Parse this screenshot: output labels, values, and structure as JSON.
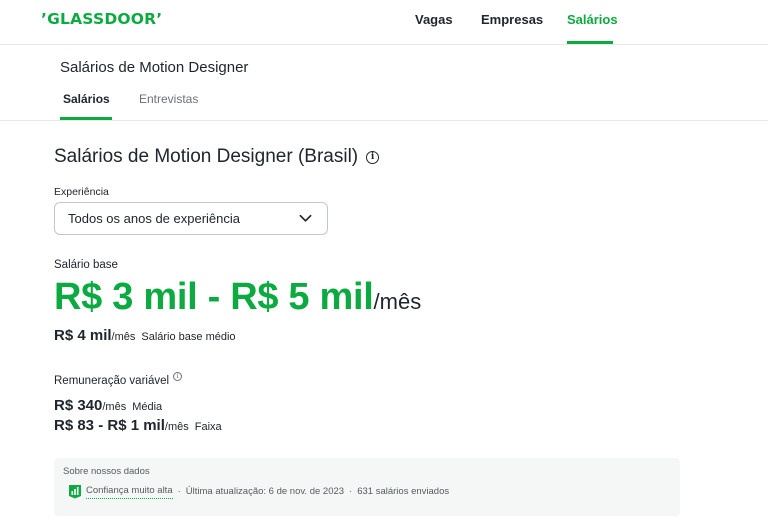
{
  "brand": {
    "logo_text": "’GLASSDOOR’",
    "accent": "#0caa41"
  },
  "nav": {
    "items": [
      {
        "label": "Vagas",
        "active": false
      },
      {
        "label": "Empresas",
        "active": false
      },
      {
        "label": "Salários",
        "active": true
      }
    ]
  },
  "subheader": {
    "title": "Salários de Motion Designer",
    "tabs": [
      {
        "label": "Salários",
        "active": true
      },
      {
        "label": "Entrevistas",
        "active": false
      }
    ]
  },
  "main": {
    "title": "Salários de Motion Designer (Brasil)",
    "experience": {
      "label": "Experiência",
      "selected": "Todos os anos de experiência"
    },
    "base_salary": {
      "label": "Salário base",
      "range": "R$ 3 mil - R$ 5 mil",
      "per": "/mês",
      "average_value": "R$ 4 mil",
      "average_per": "/mês",
      "average_desc": "Salário base médio"
    },
    "variable_pay": {
      "label": "Remuneração variável",
      "mean_value": "R$ 340",
      "mean_per": "/mês",
      "mean_desc": "Média",
      "range_value": "R$ 83 - R$ 1 mil",
      "range_per": "/mês",
      "range_desc": "Faixa"
    }
  },
  "data_info": {
    "title": "Sobre nossos dados",
    "confidence": "Confiança muito alta",
    "updated": "Última atualização: 6 de nov. de 2023",
    "count": "631 salários enviados",
    "separator": "·"
  }
}
